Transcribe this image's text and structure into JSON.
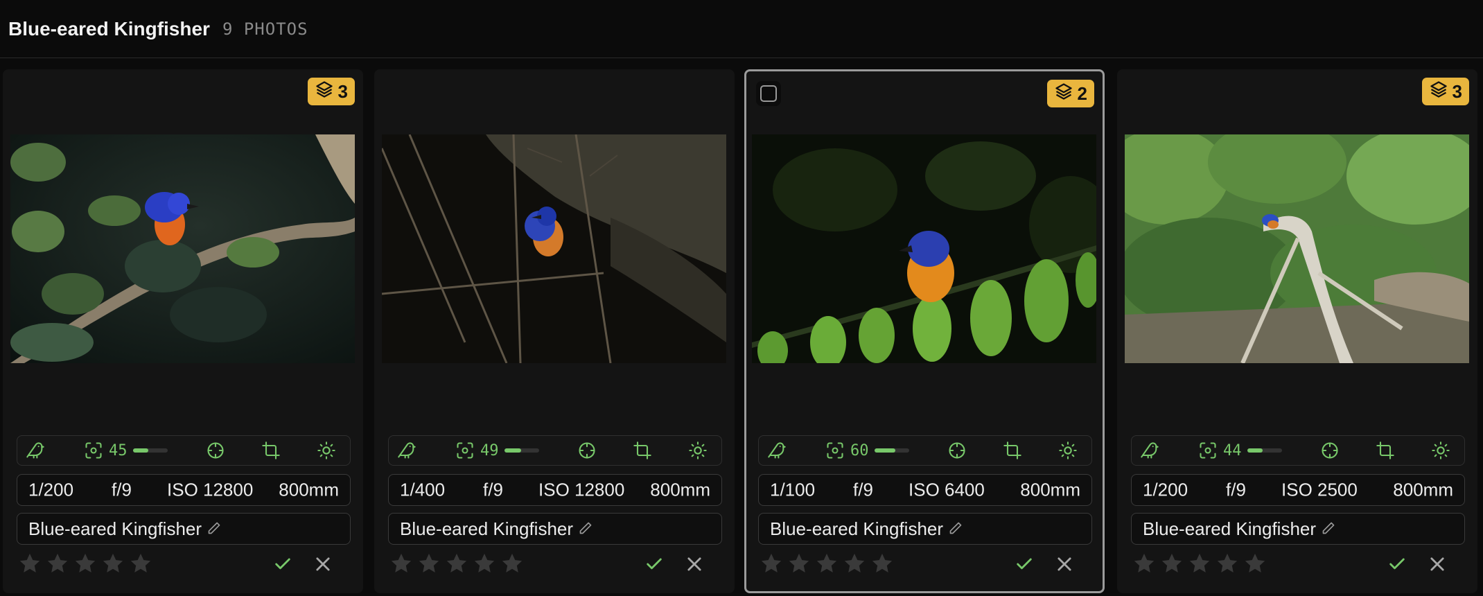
{
  "header": {
    "title": "Blue-eared Kingfisher",
    "count": "9 PHOTOS"
  },
  "colors": {
    "accent_green": "#78c86a",
    "badge_amber": "#e9b63e"
  },
  "icons": {
    "bird": "bird-icon",
    "focus": "focus-frame-icon",
    "target": "crosshair-icon",
    "crop": "crop-icon",
    "exposure": "sun-icon",
    "stack": "layers-icon",
    "edit": "pencil-icon",
    "star": "star-icon",
    "accept": "check-icon",
    "reject": "close-icon"
  },
  "cards": [
    {
      "stack_count": "3",
      "selected": false,
      "focus": {
        "value": "45",
        "level": 0.45
      },
      "exif": {
        "shutter": "1/200",
        "aperture": "f/9",
        "iso": "ISO 12800",
        "focal": "800mm"
      },
      "species": "Blue-eared Kingfisher",
      "rating": 0
    },
    {
      "stack_count": null,
      "selected": false,
      "focus": {
        "value": "49",
        "level": 0.49
      },
      "exif": {
        "shutter": "1/400",
        "aperture": "f/9",
        "iso": "ISO 12800",
        "focal": "800mm"
      },
      "species": "Blue-eared Kingfisher",
      "rating": 0
    },
    {
      "stack_count": "2",
      "selected": true,
      "focus": {
        "value": "60",
        "level": 0.6
      },
      "exif": {
        "shutter": "1/100",
        "aperture": "f/9",
        "iso": "ISO 6400",
        "focal": "800mm"
      },
      "species": "Blue-eared Kingfisher",
      "rating": 0
    },
    {
      "stack_count": "3",
      "selected": false,
      "focus": {
        "value": "44",
        "level": 0.44
      },
      "exif": {
        "shutter": "1/200",
        "aperture": "f/9",
        "iso": "ISO 2500",
        "focal": "800mm"
      },
      "species": "Blue-eared Kingfisher",
      "rating": 0
    }
  ]
}
